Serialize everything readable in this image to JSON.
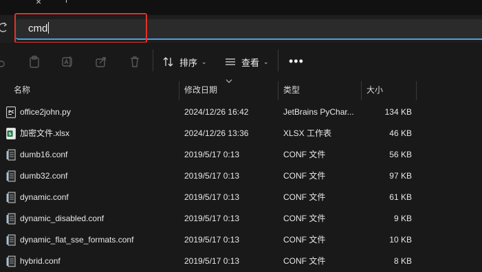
{
  "address_bar": {
    "value": "cmd"
  },
  "toolbar": {
    "sort_label": "排序",
    "view_label": "查看",
    "more_label": "•••"
  },
  "columns": {
    "name": "名称",
    "modified": "修改日期",
    "type": "类型",
    "size": "大小"
  },
  "files": [
    {
      "name": "office2john.py",
      "modified": "2024/12/26 16:42",
      "type": "JetBrains PyChar...",
      "size": "134 KB",
      "icon": "pycharm-file-icon"
    },
    {
      "name": "加密文件.xlsx",
      "modified": "2024/12/26 13:36",
      "type": "XLSX 工作表",
      "size": "46 KB",
      "icon": "spreadsheet-file-icon"
    },
    {
      "name": "dumb16.conf",
      "modified": "2019/5/17 0:13",
      "type": "CONF 文件",
      "size": "56 KB",
      "icon": "conf-file-icon"
    },
    {
      "name": "dumb32.conf",
      "modified": "2019/5/17 0:13",
      "type": "CONF 文件",
      "size": "97 KB",
      "icon": "conf-file-icon"
    },
    {
      "name": "dynamic.conf",
      "modified": "2019/5/17 0:13",
      "type": "CONF 文件",
      "size": "61 KB",
      "icon": "conf-file-icon"
    },
    {
      "name": "dynamic_disabled.conf",
      "modified": "2019/5/17 0:13",
      "type": "CONF 文件",
      "size": "9 KB",
      "icon": "conf-file-icon"
    },
    {
      "name": "dynamic_flat_sse_formats.conf",
      "modified": "2019/5/17 0:13",
      "type": "CONF 文件",
      "size": "10 KB",
      "icon": "conf-file-icon"
    },
    {
      "name": "hybrid.conf",
      "modified": "2019/5/17 0:13",
      "type": "CONF 文件",
      "size": "8 KB",
      "icon": "conf-file-icon"
    }
  ],
  "colors": {
    "background": "#191919",
    "address_focus": "#4aa3e6",
    "highlight_box": "#e3322b"
  }
}
